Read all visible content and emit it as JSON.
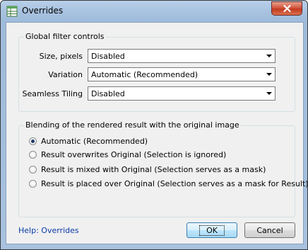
{
  "window": {
    "title": "Overrides"
  },
  "global": {
    "legend": "Global filter controls",
    "fields": [
      {
        "label": "Size, pixels",
        "value": "Disabled"
      },
      {
        "label": "Variation",
        "value": "Automatic (Recommended)"
      },
      {
        "label": "Seamless Tiling",
        "value": "Disabled"
      }
    ]
  },
  "blending": {
    "legend": "Blending of the rendered result with the original image",
    "options": [
      {
        "label": "Automatic (Recommended)",
        "checked": true
      },
      {
        "label": "Result overwrites Original (Selection is ignored)",
        "checked": false
      },
      {
        "label": "Result is mixed with Original (Selection serves as a mask)",
        "checked": false
      },
      {
        "label": "Result is placed over Original (Selection serves as a mask for Result)",
        "checked": false
      }
    ]
  },
  "footer": {
    "help_link": "Help: Overrides",
    "ok_label": "OK",
    "cancel_label": "Cancel"
  }
}
